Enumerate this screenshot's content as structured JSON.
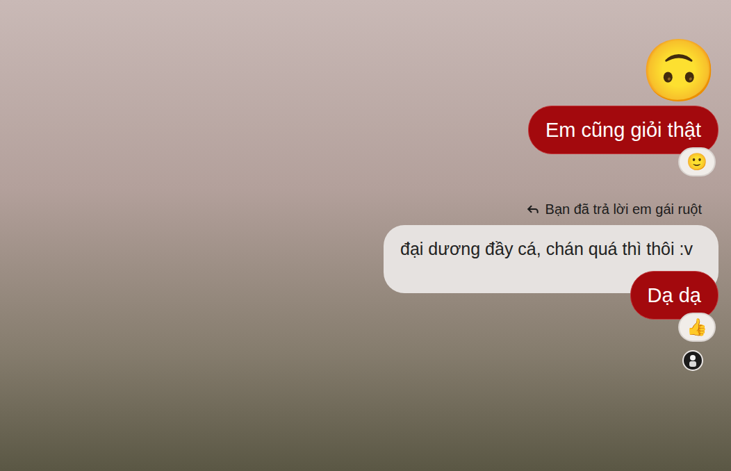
{
  "background": {
    "kind": "photo"
  },
  "messages": [
    {
      "kind": "emoji",
      "text": "🙃"
    },
    {
      "kind": "text",
      "text": "Em cũng giỏi thật",
      "reaction": "🙂"
    },
    {
      "kind": "reply-label",
      "text": "Bạn đã trả lời em gái ruột"
    },
    {
      "kind": "quote",
      "text": "đại dương đầy cá, chán quá thì thôi :v"
    },
    {
      "kind": "text",
      "text": "Dạ dạ",
      "reaction": "👍"
    }
  ],
  "seen": true
}
